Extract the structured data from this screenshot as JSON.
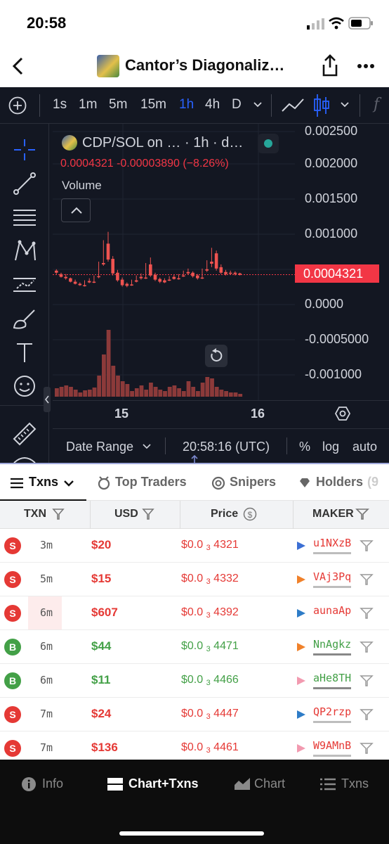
{
  "status": {
    "time": "20:58"
  },
  "nav": {
    "title": "Cantor’s Diagonaliz…"
  },
  "timeframes": [
    "1s",
    "1m",
    "5m",
    "15m",
    "1h",
    "4h",
    "D"
  ],
  "active_timeframe": "1h",
  "chart_legend": {
    "title": "CDP/SOL on …  · 1h · d…",
    "values": "0.0004321  -0.00003890 (−8.26%)",
    "volume": "Volume"
  },
  "price_axis": {
    "ticks": [
      "0.002500",
      "0.002000",
      "0.001500",
      "0.001000",
      "0.0000",
      "-0.0005000",
      "-0.001000"
    ],
    "last_price": "0.0004321"
  },
  "time_axis": {
    "ticks": [
      "15",
      "16"
    ]
  },
  "chart_footer": {
    "date_range": "Date Range",
    "clock": "20:58:16 (UTC)",
    "percent": "%",
    "log": "log",
    "auto": "auto"
  },
  "tabs": [
    {
      "label": "Txns"
    },
    {
      "label": "Top Traders"
    },
    {
      "label": "Snipers"
    },
    {
      "label": "Holders"
    }
  ],
  "tab_extra": "(9",
  "table": {
    "headers": {
      "txn": "TXN",
      "usd": "USD",
      "price": "Price",
      "maker": "MAKER"
    },
    "rows": [
      {
        "side": "S",
        "age": "3m",
        "usd": "$20",
        "price_prefix": "$0.0",
        "price_sub": "3",
        "price_digits": "4321",
        "maker": "u1NXzB"
      },
      {
        "side": "S",
        "age": "5m",
        "usd": "$15",
        "price_prefix": "$0.0",
        "price_sub": "3",
        "price_digits": "4332",
        "maker": "VAj3Pq"
      },
      {
        "side": "S",
        "age": "6m",
        "usd": "$607",
        "price_prefix": "$0.0",
        "price_sub": "3",
        "price_digits": "4392",
        "maker": "aunaAp"
      },
      {
        "side": "B",
        "age": "6m",
        "usd": "$44",
        "price_prefix": "$0.0",
        "price_sub": "3",
        "price_digits": "4471",
        "maker": "NnAgkz"
      },
      {
        "side": "B",
        "age": "6m",
        "usd": "$11",
        "price_prefix": "$0.0",
        "price_sub": "3",
        "price_digits": "4466",
        "maker": "aHe8TH"
      },
      {
        "side": "S",
        "age": "7m",
        "usd": "$24",
        "price_prefix": "$0.0",
        "price_sub": "3",
        "price_digits": "4447",
        "maker": "QP2rzp"
      },
      {
        "side": "S",
        "age": "7m",
        "usd": "$136",
        "price_prefix": "$0.0",
        "price_sub": "3",
        "price_digits": "4461",
        "maker": "W9AMnB"
      }
    ]
  },
  "bottom_nav": [
    {
      "label": "Info"
    },
    {
      "label": "Chart+Txns"
    },
    {
      "label": "Chart"
    },
    {
      "label": "Txns"
    }
  ],
  "colors": {
    "sell": "#e53935",
    "buy": "#43a047",
    "chart_bg": "#131722",
    "accent": "#2962ff",
    "candle_up": "#26a69a",
    "candle_down": "#ef5350"
  },
  "icons": [
    "back-chevron-icon",
    "share-icon",
    "more-icon",
    "plus-circle-icon",
    "line-chart-icon",
    "candlestick-icon",
    "crosshair-icon",
    "trendline-icon",
    "fib-icon",
    "pattern-icon",
    "measure-icon",
    "brush-icon",
    "text-icon",
    "emoji-icon",
    "ruler-icon",
    "reset-icon",
    "settings-icon",
    "filter-icon",
    "info-icon"
  ]
}
